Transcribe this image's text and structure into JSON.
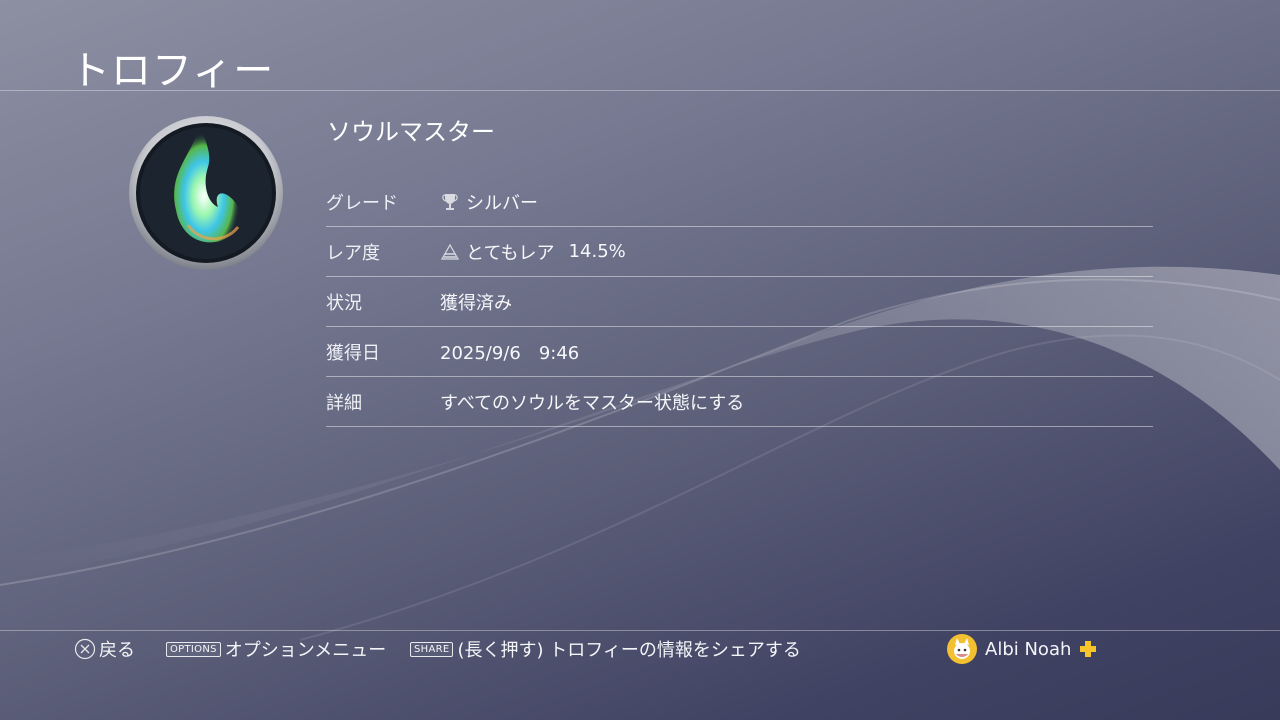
{
  "header": {
    "title": "トロフィー"
  },
  "trophy": {
    "name": "ソウルマスター",
    "icon": "soul-flame-icon"
  },
  "details": {
    "grade": {
      "label": "グレード",
      "value": "シルバー",
      "icon": "silver-trophy-icon"
    },
    "rarity": {
      "label": "レア度",
      "value": "とてもレア",
      "percent": "14.5%",
      "icon": "rarity-pyramid-icon"
    },
    "status": {
      "label": "状況",
      "value": "獲得済み"
    },
    "earned_date": {
      "label": "獲得日",
      "value": "2025/9/6　9:46"
    },
    "description": {
      "label": "詳細",
      "value": "すべてのソウルをマスター状態にする"
    }
  },
  "footer": {
    "back": {
      "label": "戻る",
      "icon": "cross-button-icon"
    },
    "options": {
      "key": "OPTIONS",
      "label": "オプションメニュー"
    },
    "share": {
      "key": "SHARE",
      "label": "(長く押す) トロフィーの情報をシェアする"
    },
    "user": {
      "name": "Albi Noah",
      "plus_icon": "ps-plus-icon"
    }
  },
  "colors": {
    "plus": "#f7c42b",
    "avatar": "#f2c030"
  }
}
